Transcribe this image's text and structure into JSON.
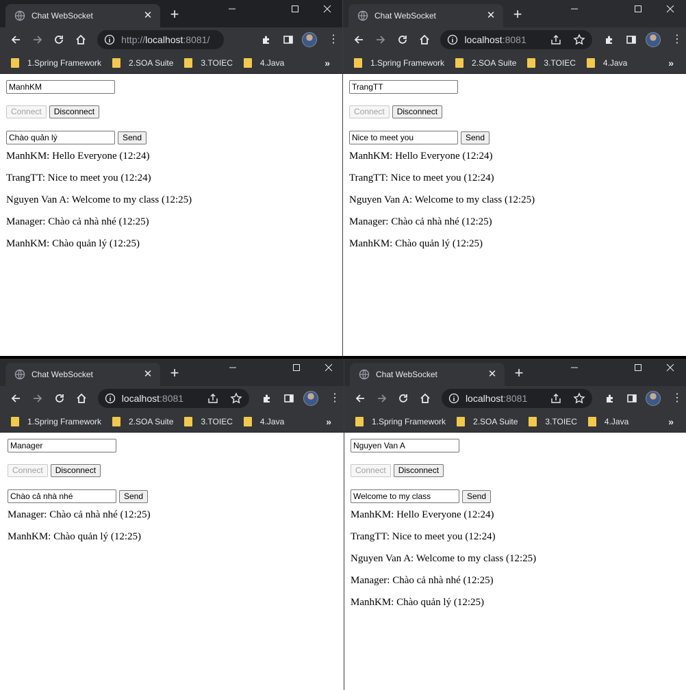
{
  "tab_title": "Chat WebSocket",
  "bookmarks": [
    "1.Spring Framework",
    "2.SOA Suite",
    "3.TOIEC",
    "4.Java"
  ],
  "more_bookmarks": "»",
  "buttons": {
    "connect": "Connect",
    "disconnect": "Disconnect",
    "send": "Send"
  },
  "windows": {
    "tl": {
      "url_prefix": "http://",
      "url_host": "localhost",
      "url_suffix": ":8081/",
      "name": "ManhKM",
      "message": "Chào quản lý",
      "messages": [
        "ManhKM: Hello Everyone (12:24)",
        "TrangTT: Nice to meet you (12:24)",
        "Nguyen Van A: Welcome to my class (12:25)",
        "Manager: Chào cả nhà nhé (12:25)",
        "ManhKM: Chào quản lý (12:25)"
      ]
    },
    "tr": {
      "url_prefix": "",
      "url_host": "localhost",
      "url_suffix": ":8081",
      "name": "TrangTT",
      "message": "Nice to meet you",
      "messages": [
        "ManhKM: Hello Everyone (12:24)",
        "TrangTT: Nice to meet you (12:24)",
        "Nguyen Van A: Welcome to my class (12:25)",
        "Manager: Chào cả nhà nhé (12:25)",
        "ManhKM: Chào quản lý (12:25)"
      ]
    },
    "bl": {
      "url_prefix": "",
      "url_host": "localhost",
      "url_suffix": ":8081",
      "name": "Manager",
      "message": "Chào cả nhà nhé",
      "messages": [
        "Manager: Chào cả nhà nhé (12:25)",
        "ManhKM: Chào quản lý (12:25)"
      ]
    },
    "br": {
      "url_prefix": "",
      "url_host": "localhost",
      "url_suffix": ":8081",
      "name": "Nguyen Van A",
      "message": "Welcome to my class",
      "messages": [
        "ManhKM: Hello Everyone (12:24)",
        "TrangTT: Nice to meet you (12:24)",
        "Nguyen Van A: Welcome to my class (12:25)",
        "Manager: Chào cả nhà nhé (12:25)",
        "ManhKM: Chào quản lý (12:25)"
      ]
    }
  },
  "colors": {
    "titlebar": "#202124",
    "toolbar": "#35363a",
    "omnibox": "#202124",
    "bookmark_folder": "#f2c94c",
    "text_light": "#e8eaed"
  },
  "icons": [
    "globe-icon",
    "close-icon",
    "new-tab-icon",
    "minimize-icon",
    "maximize-icon",
    "window-close-icon",
    "back-icon",
    "forward-icon",
    "reload-icon",
    "home-icon",
    "site-info-icon",
    "share-icon",
    "star-icon",
    "extensions-icon",
    "side-panel-icon",
    "profile-avatar",
    "menu-icon",
    "folder-icon"
  ]
}
